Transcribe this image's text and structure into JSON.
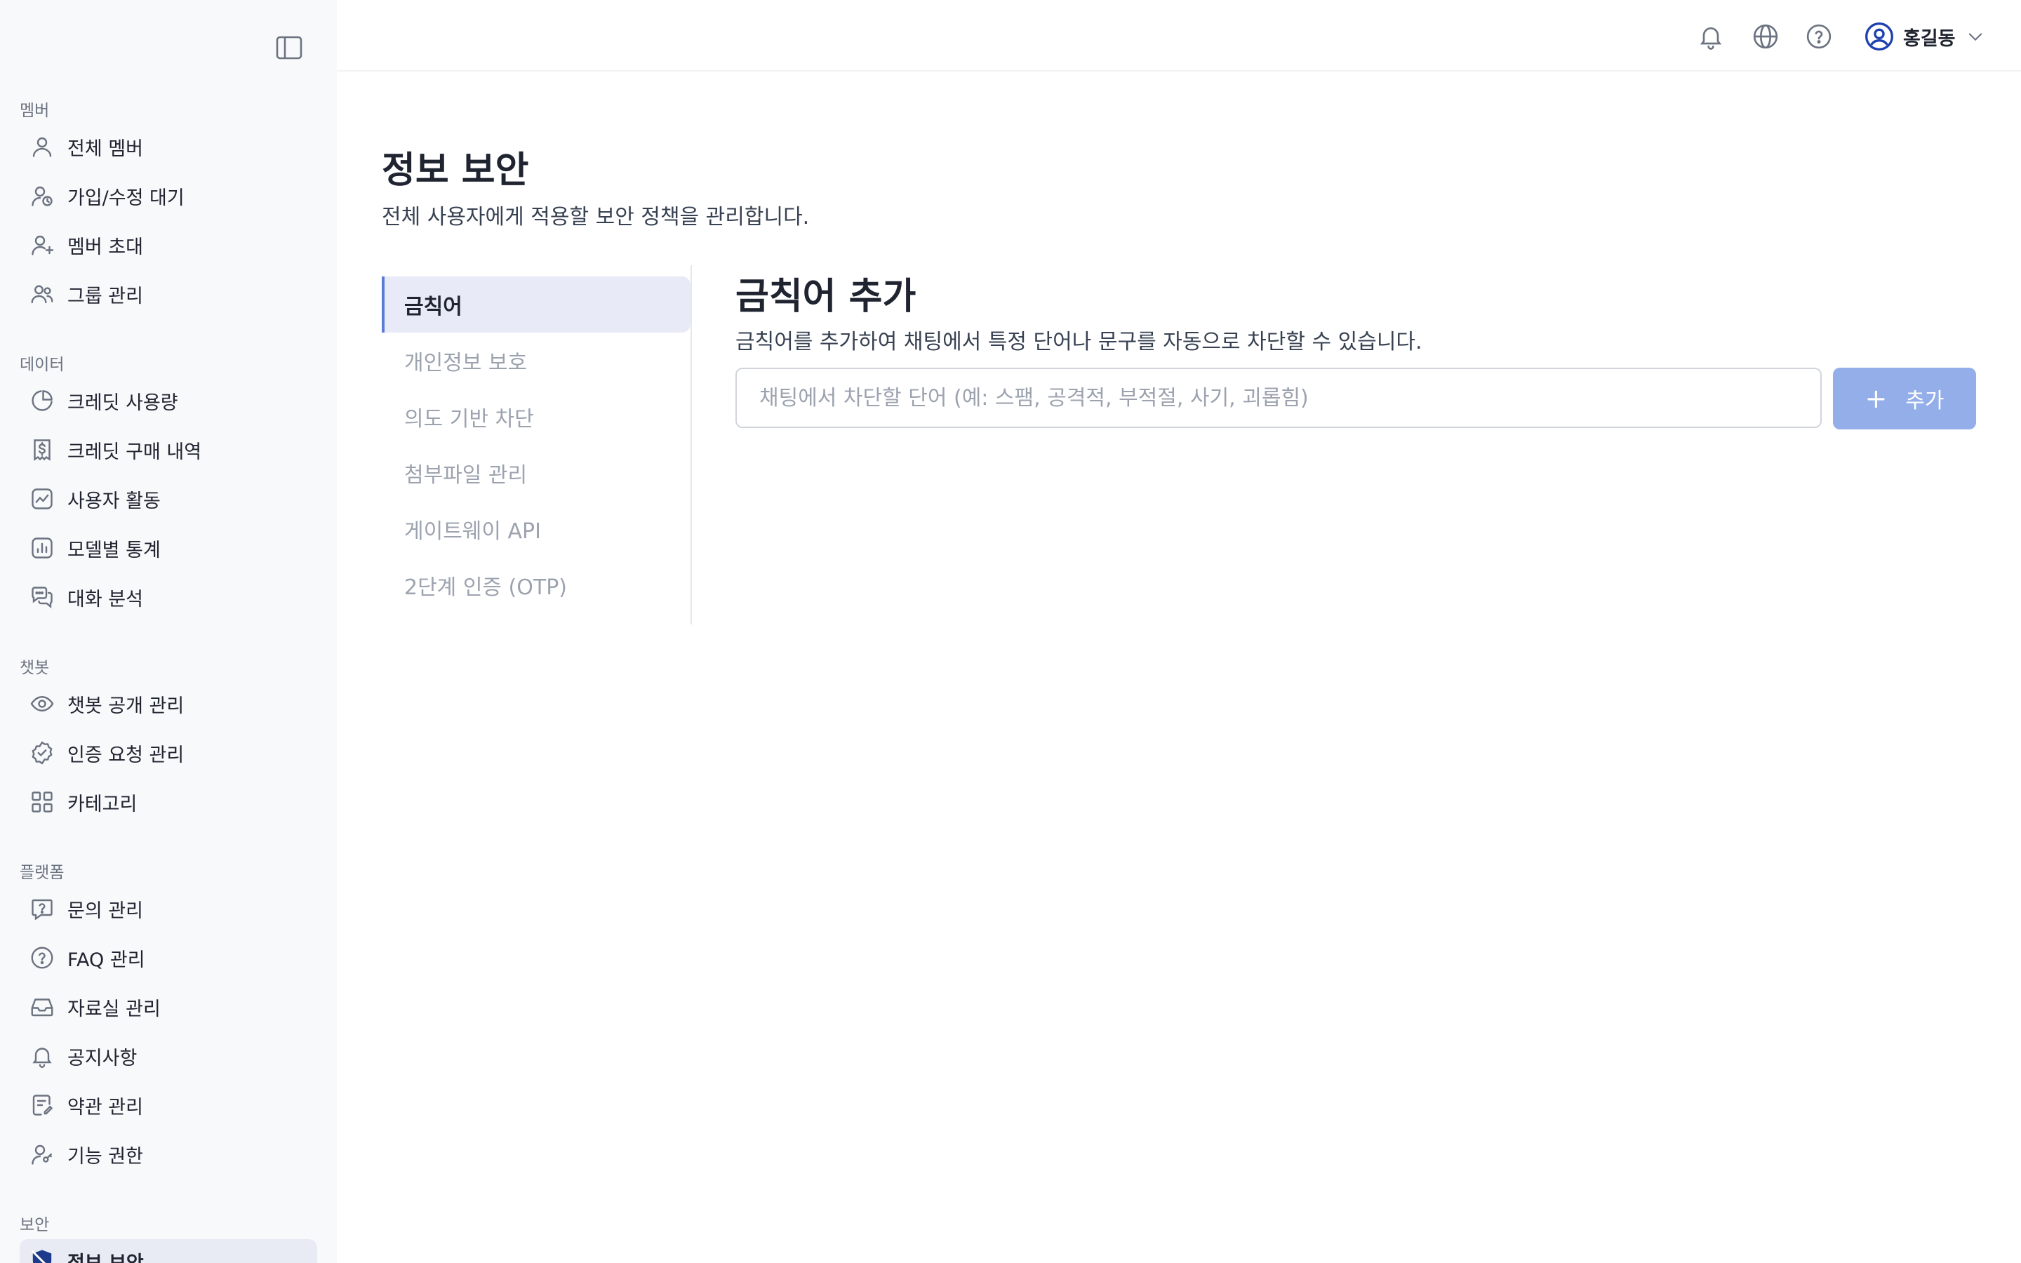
{
  "sidebar": {
    "sections": {
      "member": "멤버",
      "data": "데이터",
      "chatbot": "챗봇",
      "platform": "플랫폼",
      "security": "보안"
    },
    "items": {
      "all_members": "전체 멤버",
      "pending": "가입/수정 대기",
      "invite": "멤버 초대",
      "groups": "그룹 관리",
      "credit_usage": "크레딧 사용량",
      "credit_purchase": "크레딧 구매 내역",
      "user_activity": "사용자 활동",
      "model_stats": "모델별 통계",
      "chat_analysis": "대화 분석",
      "chatbot_public": "챗봇 공개 관리",
      "auth_requests": "인증 요청 관리",
      "category": "카테고리",
      "inquiry": "문의 관리",
      "faq": "FAQ 관리",
      "library": "자료실 관리",
      "notice": "공지사항",
      "terms": "약관 관리",
      "permissions": "기능 권한",
      "info_security": "정보 보안"
    }
  },
  "header": {
    "user_name": "홍길동"
  },
  "page": {
    "title": "정보 보안",
    "description": "전체 사용자에게 적용할 보안 정책을 관리합니다."
  },
  "tabs": {
    "banned_words": "금칙어",
    "privacy": "개인정보 보호",
    "intent_block": "의도 기반 차단",
    "attachments": "첨부파일 관리",
    "gateway_api": "게이트웨이 API",
    "otp": "2단계 인증 (OTP)"
  },
  "banned": {
    "title": "금칙어 추가",
    "description": "금칙어를 추가하여 채팅에서 특정 단어나 문구를 자동으로 차단할 수 있습니다.",
    "placeholder": "채팅에서 차단할 단어 (예: 스팸, 공격적, 부적절, 사기, 괴롭힘)",
    "add_label": "추가",
    "add_symbol": "+"
  },
  "colors": {
    "accent": "#5b7bd5",
    "button": "#93aee8",
    "active_tab_bg": "#e8ebf7",
    "sidebar_bg": "#f8f9fb"
  }
}
